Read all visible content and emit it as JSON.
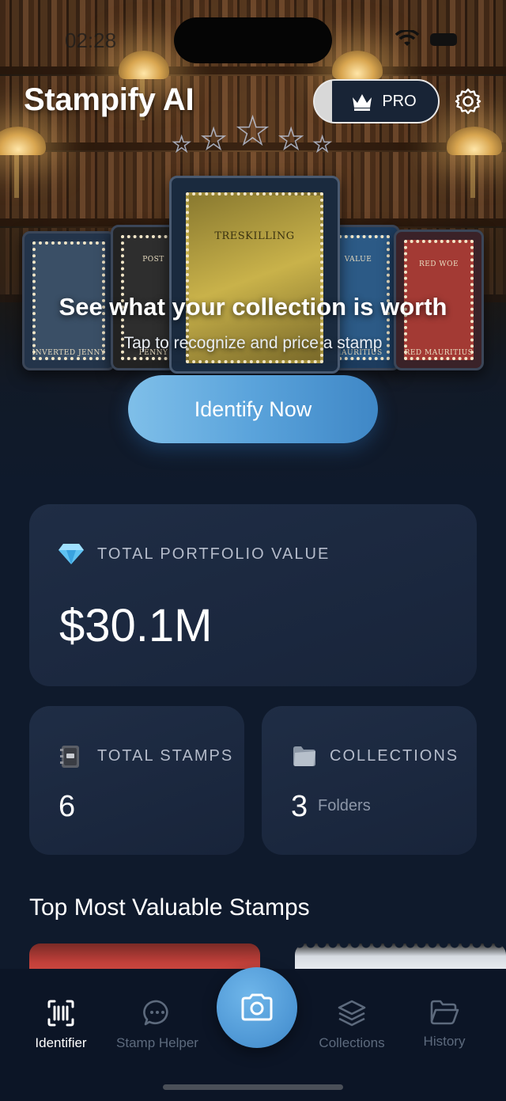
{
  "status_bar": {
    "time": "02:28"
  },
  "header": {
    "app_title": "Stampify AI",
    "pro_label": "PRO"
  },
  "hero": {
    "headline": "See what your collection is worth",
    "subtitle": "Tap to recognize and price a stamp",
    "cta_label": "Identify Now",
    "stamp_captions": [
      "TRESKILLING",
      "POST",
      "VALUE",
      "RED WOE",
      "INVERTED JENNY",
      "PENNY",
      "MAURITIUS",
      "RED MAURITIUS"
    ]
  },
  "portfolio": {
    "label": "TOTAL PORTFOLIO VALUE",
    "value": "$30.1M",
    "icon": "gem-icon"
  },
  "stats": {
    "stamps": {
      "label": "TOTAL STAMPS",
      "value": "6",
      "icon": "notebook-icon"
    },
    "collections": {
      "label": "COLLECTIONS",
      "value": "3",
      "unit": "Folders",
      "icon": "folder-icon"
    }
  },
  "top_section": {
    "title": "Top Most Valuable Stamps"
  },
  "tabbar": {
    "tabs": [
      {
        "label": "Identifier",
        "icon": "scan-icon",
        "active": true
      },
      {
        "label": "Stamp Helper",
        "icon": "chat-icon",
        "active": false
      },
      {
        "label": "Collections",
        "icon": "layers-icon",
        "active": false
      },
      {
        "label": "History",
        "icon": "folder-open-icon",
        "active": false
      }
    ],
    "camera_icon": "camera-icon"
  },
  "colors": {
    "accent": "#5aa3db",
    "background": "#0f1a2c",
    "card": "#1c2940"
  }
}
